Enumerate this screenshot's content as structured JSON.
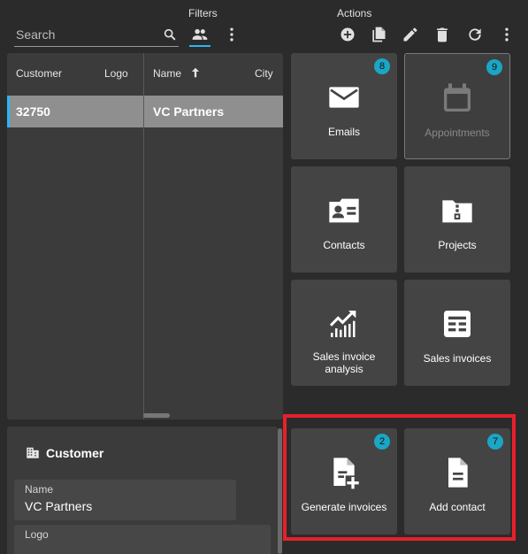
{
  "filters": {
    "title": "Filters",
    "search_placeholder": "Search"
  },
  "actions": {
    "title": "Actions"
  },
  "grid": {
    "columns": [
      "Customer",
      "Logo",
      "Name",
      "City"
    ],
    "rows": [
      {
        "customer": "32750",
        "name": "VC Partners"
      }
    ]
  },
  "details": {
    "title": "Customer",
    "fields": [
      {
        "label": "Name",
        "value": "VC Partners"
      },
      {
        "label": "Logo",
        "value": ""
      }
    ]
  },
  "tiles": [
    {
      "label": "Emails",
      "badge": "8",
      "icon": "envelope-icon"
    },
    {
      "label": "Appointments",
      "badge": "9",
      "icon": "calendar-icon",
      "disabled": true
    },
    {
      "label": "Contacts",
      "icon": "contact-card-icon"
    },
    {
      "label": "Projects",
      "icon": "folder-zip-icon"
    },
    {
      "label": "Sales invoice analysis",
      "icon": "trending-chart-icon"
    },
    {
      "label": "Sales invoices",
      "icon": "invoice-list-icon"
    },
    {
      "label": "Generate invoices",
      "badge": "2",
      "icon": "file-plus-icon"
    },
    {
      "label": "Add contact",
      "badge": "7",
      "icon": "document-icon"
    }
  ],
  "colors": {
    "accent": "#29b6f6",
    "badge": "#1aa6c4",
    "highlight": "#e8202a",
    "selected_row": "#8f8f8f"
  }
}
